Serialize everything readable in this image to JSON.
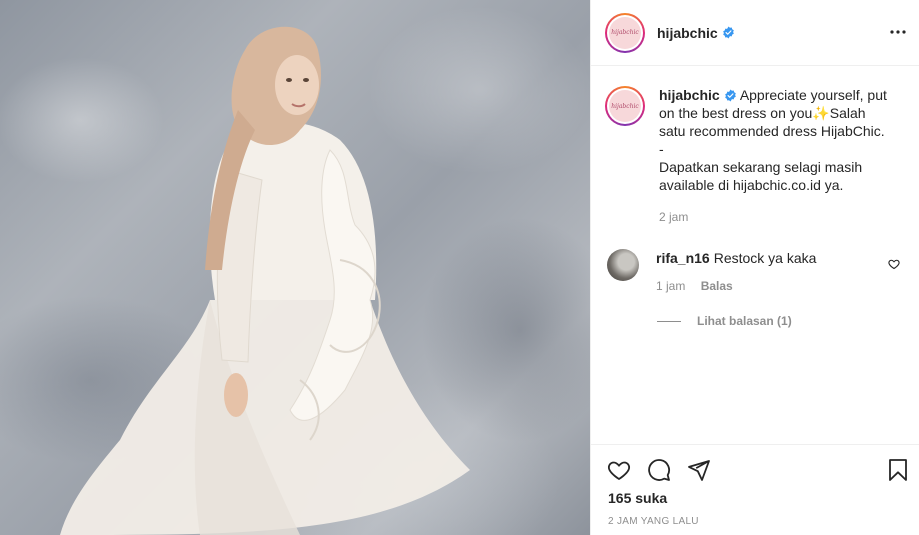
{
  "post": {
    "image_alt": "Woman in a beige hijab and white ruffled dress against a grey backdrop"
  },
  "header": {
    "avatar_text": "hijabchic",
    "username": "hijabchic",
    "verified_icon": "verified-badge-icon",
    "more_icon": "more-options-icon"
  },
  "caption": {
    "username": "hijabchic",
    "lines": [
      "Appreciate yourself, put",
      "on the best dress on you✨Salah",
      "satu recommended dress HijabChic.",
      "-",
      "Dapatkan sekarang selagi masih",
      "available di hijabchic.co.id ya."
    ],
    "time": "2 jam"
  },
  "comment": {
    "username": "rifa_n16",
    "text": "Restock ya kaka",
    "time": "1 jam",
    "reply_label": "Balas",
    "view_replies": "Lihat balasan (1)"
  },
  "actions": {
    "like_icon": "heart-icon",
    "comment_icon": "comment-icon",
    "share_icon": "share-icon",
    "save_icon": "bookmark-icon",
    "likes": "165 suka",
    "posted_ago": "2 JAM YANG LALU"
  },
  "colors": {
    "verified": "#3897f0",
    "text": "#262626",
    "secondary": "#8e8e8e",
    "border": "#efefef"
  }
}
